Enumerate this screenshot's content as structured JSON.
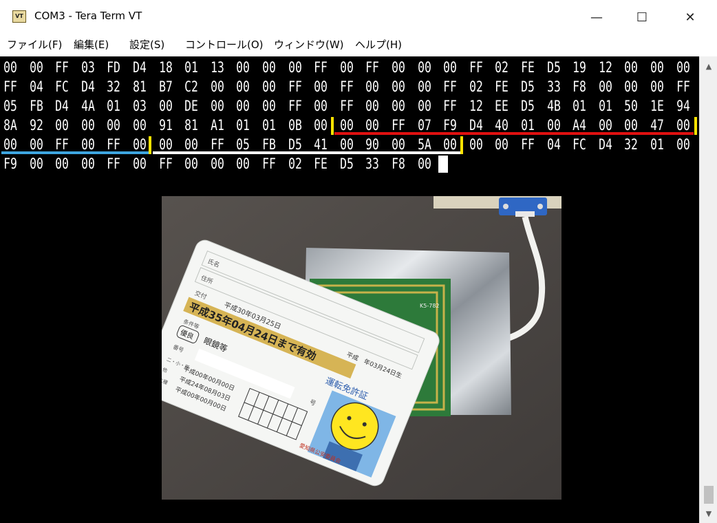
{
  "window": {
    "app_icon_text": "VT",
    "title": "COM3 - Tera Term VT",
    "minimize_glyph": "—",
    "maximize_glyph": "☐",
    "close_glyph": "✕"
  },
  "menu": {
    "items": [
      "ファイル(F)",
      "編集(E)",
      "設定(S)",
      "コントロール(O)",
      "ウィンドウ(W)",
      "ヘルプ(H)"
    ]
  },
  "terminal": {
    "lines": [
      [
        "00",
        "00",
        "FF",
        "03",
        "FD",
        "D4",
        "18",
        "01",
        "13",
        "00",
        "00",
        "00",
        "FF",
        "00",
        "FF",
        "00",
        "00",
        "00",
        "FF",
        "02",
        "FE",
        "D5",
        "19",
        "12",
        "00",
        "00",
        "00"
      ],
      [
        "FF",
        "04",
        "FC",
        "D4",
        "32",
        "81",
        "B7",
        "C2",
        "00",
        "00",
        "00",
        "FF",
        "00",
        "FF",
        "00",
        "00",
        "00",
        "FF",
        "02",
        "FE",
        "D5",
        "33",
        "F8",
        "00",
        "00",
        "00",
        "FF"
      ],
      [
        "05",
        "FB",
        "D4",
        "4A",
        "01",
        "03",
        "00",
        "DE",
        "00",
        "00",
        "00",
        "FF",
        "00",
        "FF",
        "00",
        "00",
        "00",
        "FF",
        "12",
        "EE",
        "D5",
        "4B",
        "01",
        "01",
        "50",
        "1E",
        "94"
      ],
      [
        "8A",
        "92",
        "00",
        "00",
        "00",
        "00",
        "91",
        "81",
        "A1",
        "01",
        "01",
        "0B",
        "00",
        "00",
        "00",
        "FF",
        "07",
        "F9",
        "D4",
        "40",
        "01",
        "00",
        "A4",
        "00",
        "00",
        "47",
        "00"
      ],
      [
        "00",
        "00",
        "FF",
        "00",
        "FF",
        "00",
        "00",
        "00",
        "FF",
        "05",
        "FB",
        "D5",
        "41",
        "00",
        "90",
        "00",
        "5A",
        "00",
        "00",
        "00",
        "FF",
        "04",
        "FC",
        "D4",
        "32",
        "01",
        "00"
      ],
      [
        "F9",
        "00",
        "00",
        "00",
        "FF",
        "00",
        "FF",
        "00",
        "00",
        "00",
        "FF",
        "02",
        "FE",
        "D5",
        "33",
        "F8",
        "00"
      ]
    ],
    "highlight_colors": {
      "red": "#e01010",
      "blue": "#3ea6e0",
      "white": "#ffffff",
      "yellow": "#ffe400"
    }
  },
  "photo": {
    "card": {
      "name_label": "氏名",
      "address_label": "住所",
      "issue_label": "交付",
      "issue_date": "平成30年03月25日",
      "validity": "平成35年04月24日まで有効",
      "conditions_label": "条件等",
      "conditions": "眼鏡等",
      "good_driver_badge": "優良",
      "license_type": "運転免許証",
      "issuer": "愛知県公安委員会",
      "dates": [
        "平成00年00月00日",
        "平成24年08月03日",
        "平成00年00月00日"
      ],
      "top_right_date": "平成　年03月24日生",
      "number_label": "番号",
      "number_suffix": "号",
      "side_labels": [
        "二・小・原",
        "他",
        "二種"
      ]
    },
    "board_label": "K5-782"
  }
}
